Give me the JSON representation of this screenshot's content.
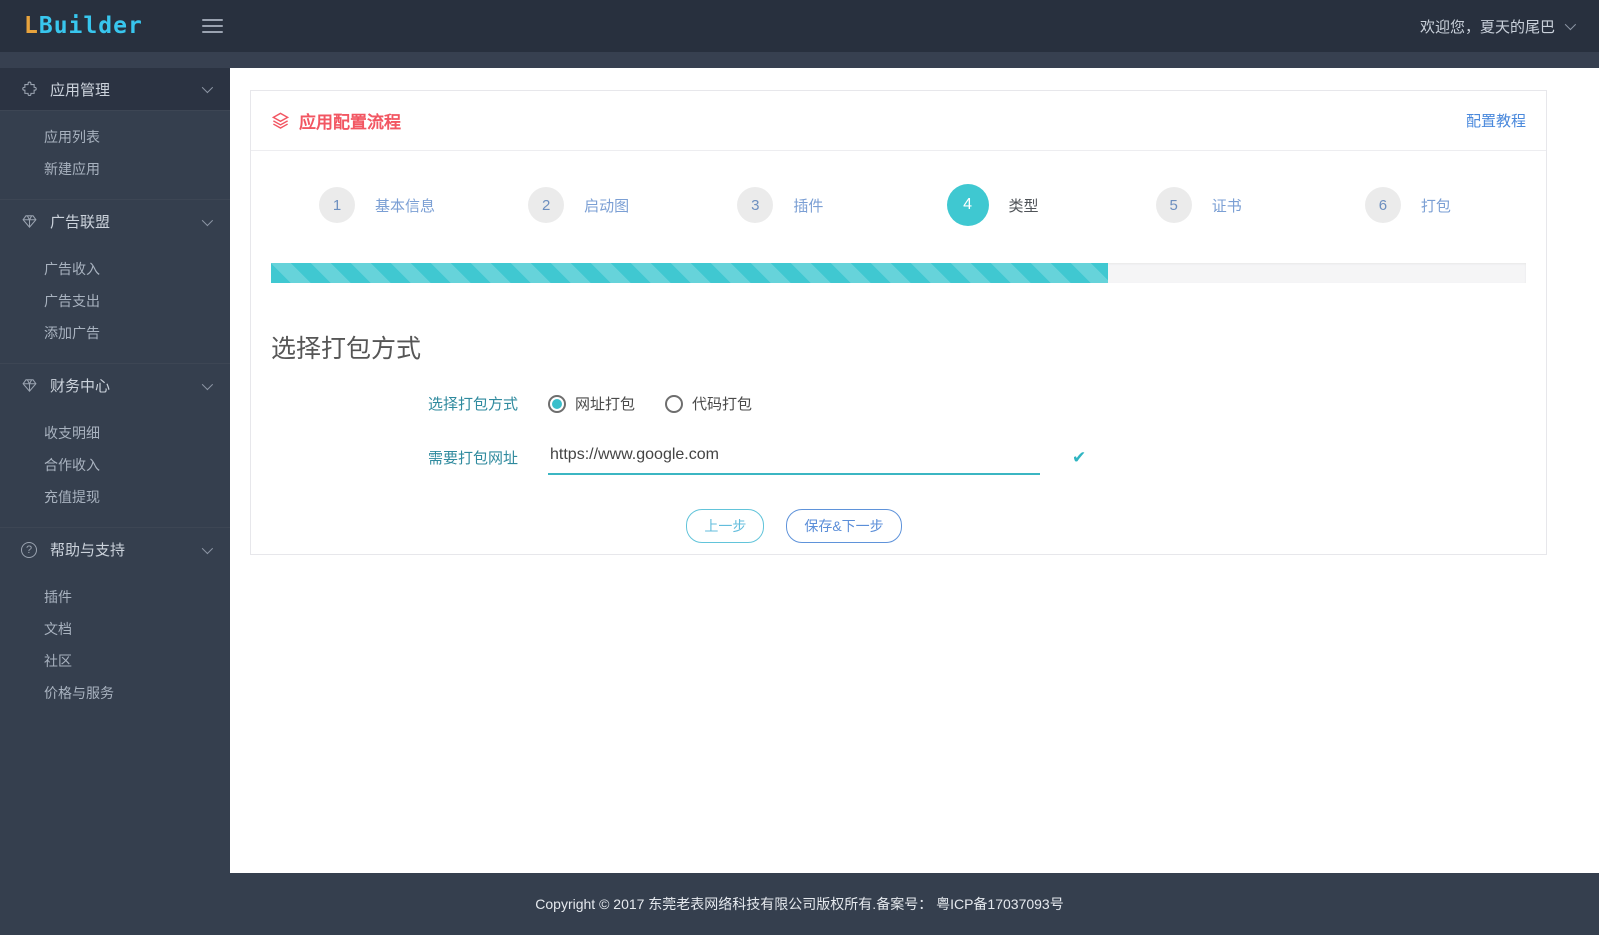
{
  "header": {
    "logo_l": "L",
    "logo_rest": "Builder",
    "user_greeting": "欢迎您，夏天的尾巴"
  },
  "sidebar": {
    "groups": [
      {
        "label": "应用管理",
        "icon": "puzzle-icon",
        "items": [
          "应用列表",
          "新建应用"
        ]
      },
      {
        "label": "广告联盟",
        "icon": "gem-icon",
        "items": [
          "广告收入",
          "广告支出",
          "添加广告"
        ]
      },
      {
        "label": "财务中心",
        "icon": "gem-icon",
        "items": [
          "收支明细",
          "合作收入",
          "充值提现"
        ]
      },
      {
        "label": "帮助与支持",
        "icon": "help-icon",
        "items": [
          "插件",
          "文档",
          "社区",
          "价格与服务"
        ]
      }
    ]
  },
  "card": {
    "title": "应用配置流程",
    "tutorial_link": "配置教程",
    "steps": [
      {
        "num": "1",
        "label": "基本信息"
      },
      {
        "num": "2",
        "label": "启动图"
      },
      {
        "num": "3",
        "label": "插件"
      },
      {
        "num": "4",
        "label": "类型"
      },
      {
        "num": "5",
        "label": "证书"
      },
      {
        "num": "6",
        "label": "打包"
      }
    ],
    "active_step": "4",
    "progress_percent": 66.7,
    "section_title": "选择打包方式",
    "form": {
      "method_label": "选择打包方式",
      "radio_url": "网址打包",
      "radio_code": "代码打包",
      "radio_selected": "网址打包",
      "url_label": "需要打包网址",
      "url_value": "https://www.google.com",
      "prev_button": "上一步",
      "save_button": "保存&下一步"
    }
  },
  "footer": {
    "copyright": "Copyright © 2017 东莞老表网络科技有限公司版权所有.备案号： 粤ICP备17037093号"
  },
  "icons": {
    "help_glyph": "?",
    "check_glyph": "✔"
  },
  "colors": {
    "accent_teal": "#3fc8d1",
    "title_red": "#f25662",
    "link_blue": "#4a89dc",
    "header_bg": "#28303e",
    "sidebar_bg": "#353f4e"
  }
}
